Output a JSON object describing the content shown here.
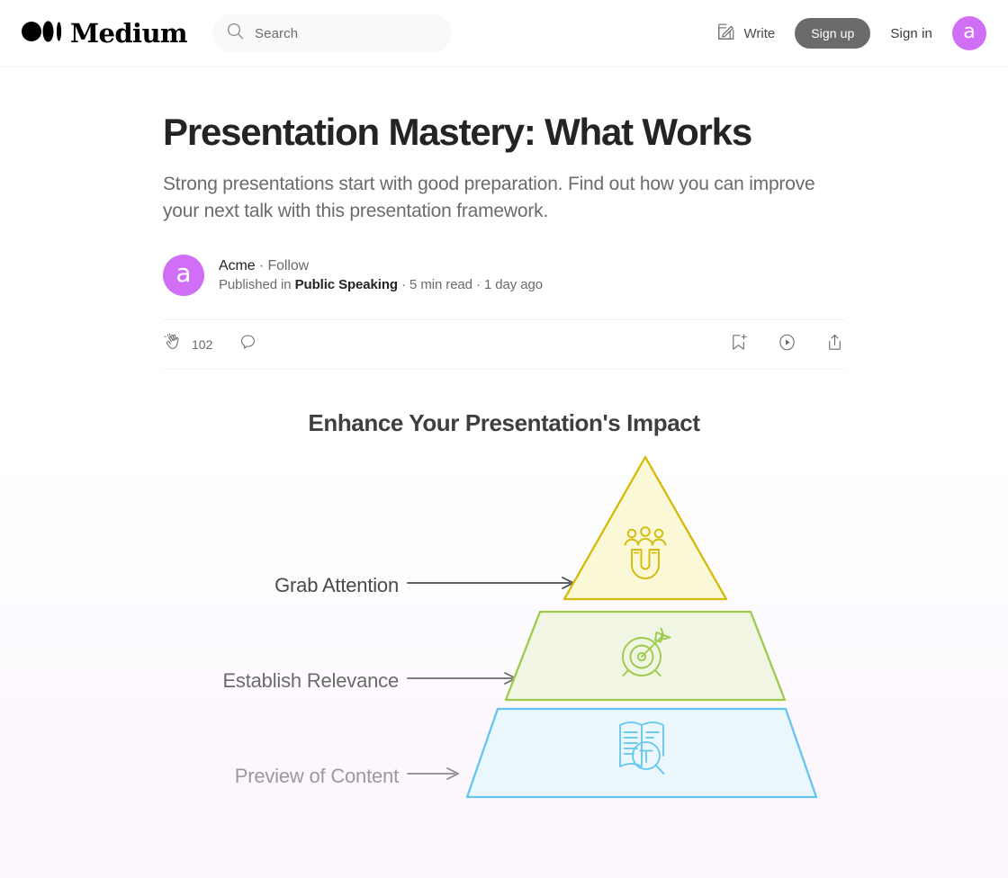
{
  "header": {
    "brand": "Medium",
    "brand_icon": "medium-logo-icon",
    "search": {
      "placeholder": "Search",
      "value": "",
      "icon": "search-icon"
    },
    "write_label": "Write",
    "write_icon": "pencil-square-icon",
    "signup_label": "Sign up",
    "signin_label": "Sign in",
    "avatar_letter": "a",
    "avatar_color": "#d06ef5",
    "signup_bg": "#6b6b6b"
  },
  "article": {
    "title": "Presentation Mastery: What Works",
    "subtitle": "Strong presentations start with good preparation. Find out how you can improve your next talk with this presentation framework.",
    "author": {
      "avatar_letter": "a",
      "name": "Acme",
      "separator": "·",
      "follow_label": "Follow"
    },
    "meta": {
      "published_in_label": "Published in",
      "publication": "Public Speaking",
      "sep1": "·",
      "read_time": "5 min read",
      "sep2": "·",
      "date": "1 day ago"
    },
    "engagement": {
      "clap_icon": "clap-icon",
      "clap_count": "102",
      "comment_icon": "comment-icon",
      "bookmark_icon": "bookmark-add-icon",
      "listen_icon": "play-circle-icon",
      "share_icon": "share-up-icon"
    }
  },
  "chart_data": {
    "type": "pyramid",
    "title": "Enhance Your Presentation's Impact",
    "orientation": "top-down",
    "levels": [
      {
        "label": "Grab Attention",
        "rank": 1,
        "shape": "triangle",
        "icon": "audience-magnet-icon",
        "stroke": "#d4bb09",
        "fill": "#fbf8d8",
        "label_color": "#4a4a4a",
        "arrow_color": "#4a4a4a"
      },
      {
        "label": "Establish Relevance",
        "rank": 2,
        "shape": "trapezoid",
        "icon": "target-arrow-icon",
        "stroke": "#9ccb4b",
        "fill": "#f0f6e3",
        "label_color": "#6b6b6b",
        "arrow_color": "#6b6b6b"
      },
      {
        "label": "Preview of Content",
        "rank": 3,
        "shape": "trapezoid",
        "icon": "book-text-search-icon",
        "stroke": "#64c5ee",
        "fill": "#eaf7fd",
        "label_color": "#9a9a9a",
        "arrow_color": "#8a8a8a"
      }
    ]
  }
}
